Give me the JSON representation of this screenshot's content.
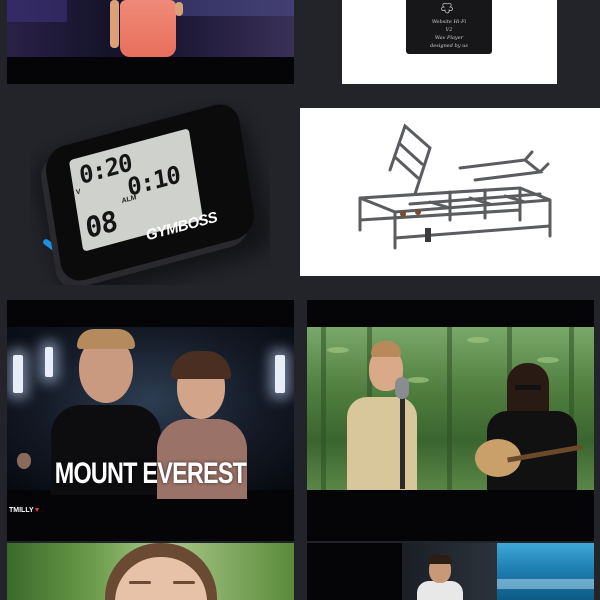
{
  "grid": {
    "tiles": [
      {
        "kind": "video",
        "subject": "dancer-on-stage"
      },
      {
        "kind": "product",
        "subject": "music-player-box",
        "box_text": [
          "Website Hi-Fi",
          "V2",
          "Wav Player",
          "designed by us"
        ]
      },
      {
        "kind": "product",
        "subject": "gymboss-interval-timer",
        "brand": "GYMBOSS",
        "display": {
          "top": "0:20",
          "middle": "0:10",
          "bottom": "08",
          "label_left": "V",
          "label_alarm": "ALM"
        }
      },
      {
        "kind": "product",
        "subject": "adjustable-bed-frame"
      },
      {
        "kind": "video",
        "subject": "dance-video",
        "title": "MOUNT EVEREST",
        "channel": "TMILLY"
      },
      {
        "kind": "video",
        "subject": "acoustic-duo-outdoors"
      },
      {
        "kind": "video",
        "subject": "close-up-face"
      },
      {
        "kind": "video",
        "subject": "speaker-and-ocean"
      }
    ]
  },
  "colors": {
    "background": "#22242a",
    "tile_black": "#050506",
    "gymboss_blue": "#1f8fe0"
  }
}
